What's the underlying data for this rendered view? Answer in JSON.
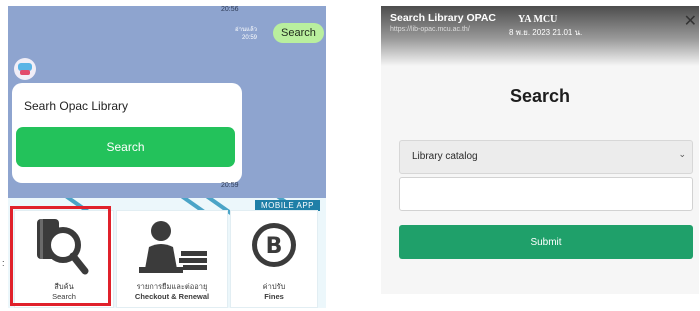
{
  "chat": {
    "time_top": "20:56",
    "read_label": "อ่านแล้ว",
    "read_time": "20:59",
    "sent_message": "Search",
    "card_title": "Searh Opac Library",
    "card_button": "Search",
    "time_bottom": "20:59"
  },
  "rich_menu": {
    "banner": "MOBILE APP",
    "items": [
      {
        "label_th": "สืบค้น",
        "label_en": "Search",
        "icon": "magnifier-book-icon"
      },
      {
        "label_th": "รายการยืมและต่ออายุ",
        "label_en": "Checkout & Renewal",
        "icon": "person-books-icon"
      },
      {
        "label_th": "ค่าปรับ",
        "label_en": "Fines",
        "icon": "baht-coin-icon"
      }
    ],
    "highlight_color": "#e0212b"
  },
  "opac": {
    "header_title": "Search Library OPAC",
    "header_url": "https://lib-opac.mcu.ac.th/",
    "brand": "YA MCU",
    "date": "8 พ.ย. 2023 21.01 น.",
    "heading": "Search",
    "select_value": "Library catalog",
    "input_value": "",
    "submit_label": "Submit",
    "accent": "#1fa06a"
  }
}
